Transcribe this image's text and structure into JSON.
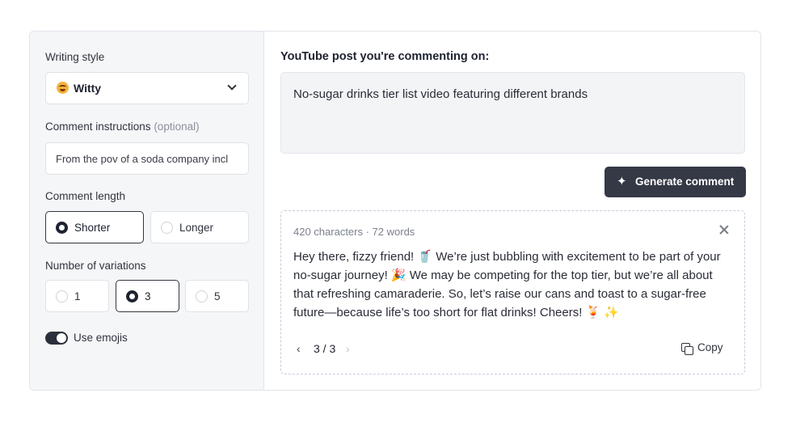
{
  "left": {
    "writing_style_label": "Writing style",
    "writing_style_value": "Witty",
    "instructions_label": "Comment instructions",
    "instructions_optional": "(optional)",
    "instructions_value": "From the pov of a soda company incl",
    "length_label": "Comment length",
    "length_options": [
      {
        "label": "Shorter",
        "selected": true
      },
      {
        "label": "Longer",
        "selected": false
      }
    ],
    "variations_label": "Number of variations",
    "variation_options": [
      {
        "label": "1",
        "selected": false
      },
      {
        "label": "3",
        "selected": true
      },
      {
        "label": "5",
        "selected": false
      }
    ],
    "use_emojis_label": "Use emojis",
    "use_emojis_on": true
  },
  "right": {
    "heading": "YouTube post you're commenting on:",
    "post_text": "No-sugar drinks tier list video featuring different brands",
    "generate_label": "Generate comment",
    "result_meta": "420 characters · 72 words",
    "comment_text": "Hey there, fizzy friend! 🥤 We’re just bubbling with excitement to be part of your no-sugar journey! 🎉 We may be competing for the top tier, but we’re all about that refreshing camaraderie. So, let’s raise our cans and toast to a sugar-free future—because life’s too short for flat drinks! Cheers! 🍹 ✨",
    "pager_prev": "‹",
    "pager": "3 / 3",
    "pager_next": "›",
    "copy_label": "Copy"
  },
  "colors": {
    "primary_button": "#353946",
    "panel_bg": "#f5f6f8"
  }
}
